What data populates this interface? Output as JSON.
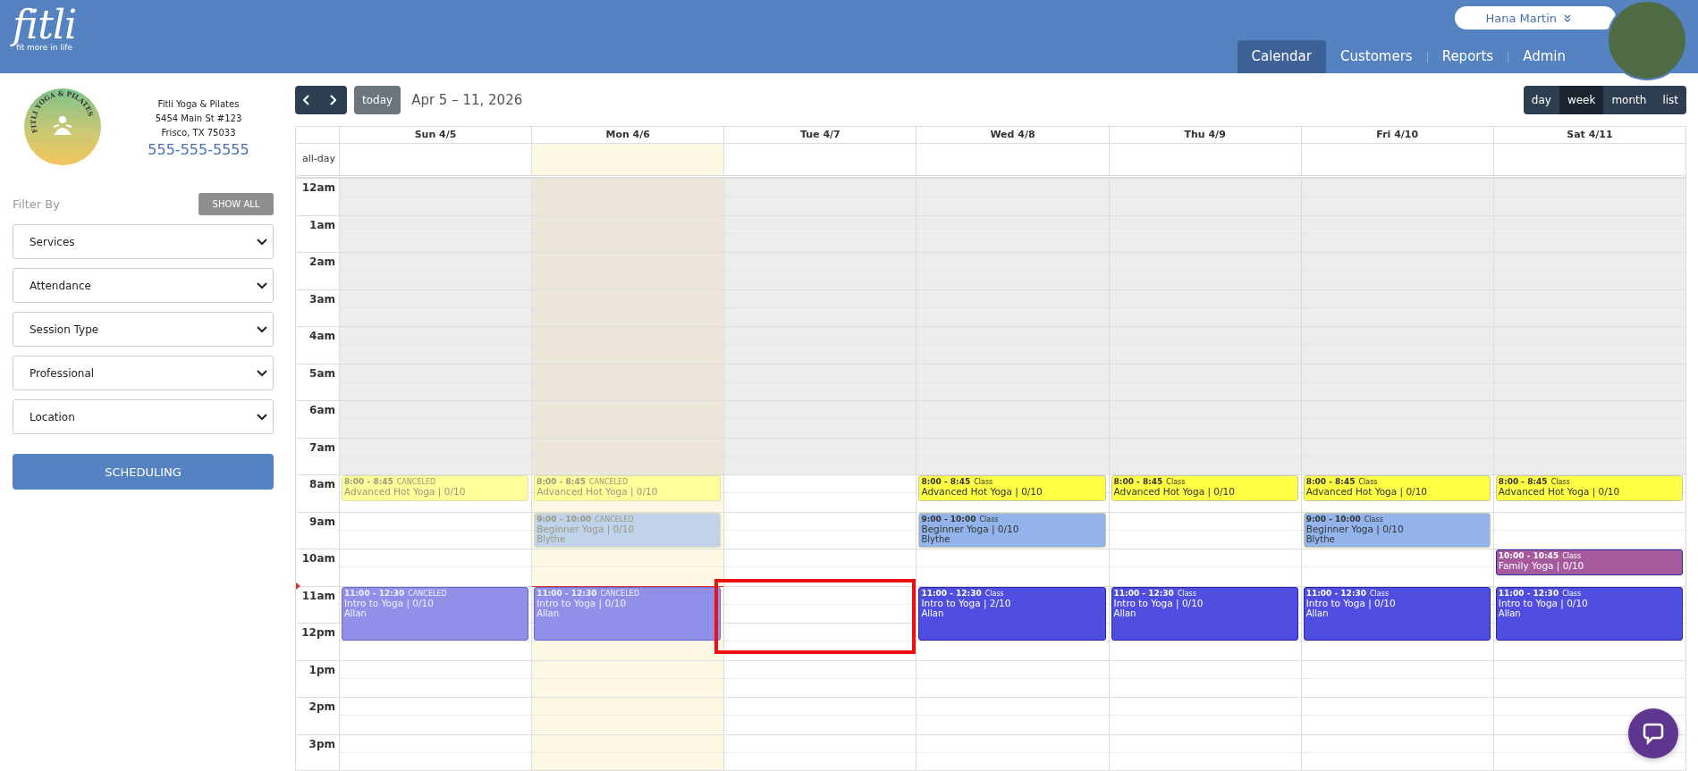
{
  "header": {
    "logo": {
      "wordmark": "fitli",
      "tagline": "fit more in life"
    },
    "user": {
      "name": "Hana Martin"
    },
    "nav": [
      {
        "label": "Calendar",
        "selected": true
      },
      {
        "label": "Customers",
        "selected": false
      },
      {
        "label": "Reports",
        "selected": false
      },
      {
        "label": "Admin",
        "selected": false
      }
    ]
  },
  "studio": {
    "logo_text": "FITLI YOGA & PILATES",
    "name": "Fitli Yoga & Pilates",
    "address_line_1": "5454 Main St #123",
    "address_line_2": "Frisco, TX 75033",
    "phone": "555-555-5555"
  },
  "filters": {
    "title": "Filter By",
    "show_all": "SHOW ALL",
    "selects": [
      "Services",
      "Attendance",
      "Session Type",
      "Professional",
      "Location"
    ],
    "scheduling": "SCHEDULING"
  },
  "toolbar": {
    "range": "Apr 5 – 11, 2026",
    "today": "today",
    "views": [
      {
        "label": "day",
        "selected": false
      },
      {
        "label": "week",
        "selected": true
      },
      {
        "label": "month",
        "selected": false
      },
      {
        "label": "list",
        "selected": false
      }
    ]
  },
  "calendar": {
    "all_day_label": "all-day",
    "days": [
      {
        "label": "Sun 4/5",
        "today": false,
        "events": [
          {
            "time": "8:00 - 8:45",
            "status": "CANCELED",
            "canceled": true,
            "title": "Advanced Hot Yoga | 0/10",
            "color": "#ffff99"
          },
          {
            "time": "11:00 - 12:30",
            "status": "CANCELED",
            "canceled": true,
            "title": "Intro to Yoga | 0/10",
            "person": "Allan",
            "color": "#9190e8"
          }
        ]
      },
      {
        "label": "Mon 4/6",
        "today": true,
        "events": [
          {
            "time": "8:00 - 8:45",
            "status": "CANCELED",
            "canceled": true,
            "title": "Advanced Hot Yoga | 0/10",
            "color": "#ffff99"
          },
          {
            "time": "9:00 - 10:00",
            "status": "CANCELED",
            "canceled": true,
            "title": "Beginner Yoga | 0/10",
            "person": "Blythe",
            "color": "#c1d3ea"
          },
          {
            "time": "11:00 - 12:30",
            "status": "CANCELED",
            "canceled": true,
            "title": "Intro to Yoga | 0/10",
            "person": "Allan",
            "color": "#9190e8"
          }
        ]
      },
      {
        "label": "Tue 4/7",
        "today": false
      },
      {
        "label": "Wed 4/8",
        "today": false,
        "events": [
          {
            "time": "8:00 - 8:45",
            "status": "Class",
            "canceled": false,
            "title": "Advanced Hot Yoga | 0/10",
            "color": "#ffff44"
          },
          {
            "time": "9:00 - 10:00",
            "status": "Class",
            "canceled": false,
            "title": "Beginner Yoga | 0/10",
            "person": "Blythe",
            "color": "#93b4ea"
          },
          {
            "time": "11:00 - 12:30",
            "status": "Class",
            "canceled": false,
            "title": "Intro to Yoga | 2/10",
            "person": "Allan",
            "color": "#4f4ee0"
          }
        ]
      },
      {
        "label": "Thu 4/9",
        "today": false,
        "events": [
          {
            "time": "8:00 - 8:45",
            "status": "Class",
            "canceled": false,
            "title": "Advanced Hot Yoga | 0/10",
            "color": "#ffff44"
          },
          {
            "time": "11:00 - 12:30",
            "status": "Class",
            "canceled": false,
            "title": "Intro to Yoga | 0/10",
            "person": "Allan",
            "color": "#4f4ee0"
          }
        ]
      },
      {
        "label": "Fri 4/10",
        "today": false,
        "events": [
          {
            "time": "8:00 - 8:45",
            "status": "Class",
            "canceled": false,
            "title": "Advanced Hot Yoga | 0/10",
            "color": "#ffff44"
          },
          {
            "time": "9:00 - 10:00",
            "status": "Class",
            "canceled": false,
            "title": "Beginner Yoga | 0/10",
            "person": "Blythe",
            "color": "#93b4ea"
          },
          {
            "time": "11:00 - 12:30",
            "status": "Class",
            "canceled": false,
            "title": "Intro to Yoga | 0/10",
            "person": "Allan",
            "color": "#4f4ee0"
          }
        ]
      },
      {
        "label": "Sat 4/11",
        "today": false,
        "events": [
          {
            "time": "8:00 - 8:45",
            "status": "Class",
            "canceled": false,
            "title": "Advanced Hot Yoga | 0/10",
            "color": "#ffff44"
          },
          {
            "time": "10:00 - 10:45",
            "status": "Class",
            "canceled": false,
            "title": "Family Yoga | 0/10",
            "color": "#a55a9e"
          },
          {
            "time": "11:00 - 12:30",
            "status": "Class",
            "canceled": false,
            "title": "Intro to Yoga | 0/10",
            "person": "Allan",
            "color": "#4f4ee0"
          }
        ]
      }
    ],
    "hours": [
      {
        "label": "12am",
        "closed": true
      },
      {
        "label": "1am",
        "closed": true
      },
      {
        "label": "2am",
        "closed": true
      },
      {
        "label": "3am",
        "closed": true
      },
      {
        "label": "4am",
        "closed": true
      },
      {
        "label": "5am",
        "closed": true
      },
      {
        "label": "6am",
        "closed": true
      },
      {
        "label": "7am",
        "closed": true
      },
      {
        "label": "8am",
        "closed": false
      },
      {
        "label": "9am",
        "closed": false
      },
      {
        "label": "10am",
        "closed": false
      },
      {
        "label": "11am",
        "closed": false
      },
      {
        "label": "12pm",
        "closed": false
      },
      {
        "label": "1pm",
        "closed": false
      },
      {
        "label": "2pm",
        "closed": false
      },
      {
        "label": "3pm",
        "closed": false
      }
    ]
  }
}
